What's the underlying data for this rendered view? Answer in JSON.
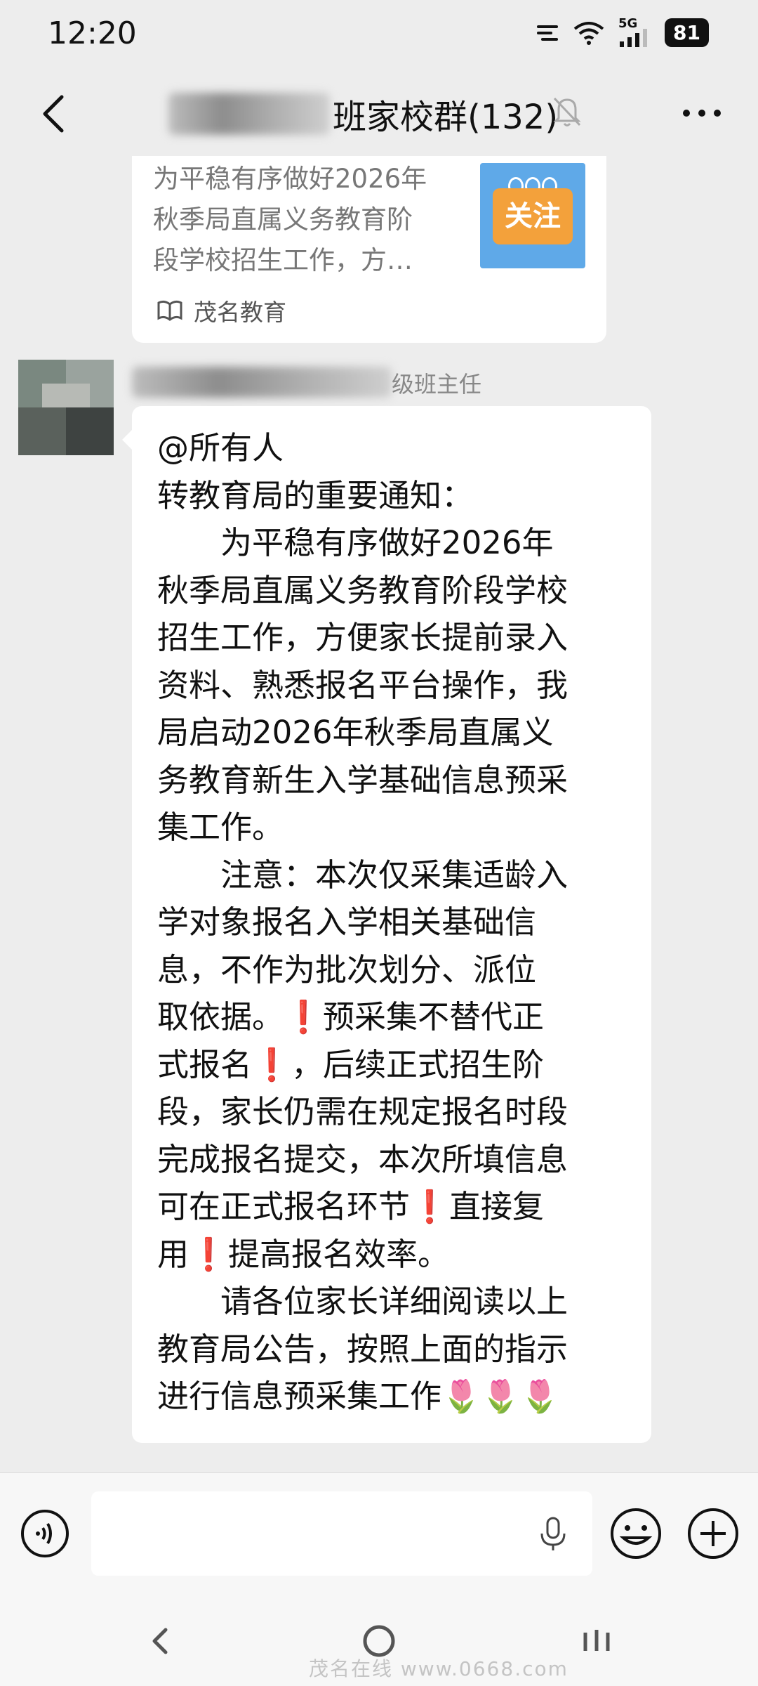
{
  "status_bar": {
    "time": "12:20",
    "network": "5G",
    "battery": "81"
  },
  "header": {
    "title": "班家校群(132)",
    "back_icon": "chevron-left-icon",
    "mute_icon": "bell-off-icon",
    "more_icon": "more-dots-icon"
  },
  "article_card": {
    "lines": [
      "为平稳有序做好2026年",
      "秋季局直属义务教育阶",
      "段学校招生工作，方…"
    ],
    "thumbnail_label": "关注",
    "source": "茂名教育",
    "source_icon": "book-open-icon"
  },
  "sender": {
    "name_suffix": "级班主任"
  },
  "message": {
    "lines": [
      "@所有人",
      "转教育局的重要通知：",
      "　　为平稳有序做好2026年",
      "秋季局直属义务教育阶段学校",
      "招生工作，方便家长提前录入",
      "资料、熟悉报名平台操作，我",
      "局启动2026年秋季局直属义",
      "务教育新生入学基础信息预采",
      "集工作。",
      "　　注意：本次仅采集适龄入",
      "学对象报名入学相关基础信",
      "息，不作为批次划分、派位",
      "取依据。❗预采集不替代正",
      "式报名❗，后续正式招生阶",
      "段，家长仍需在规定报名时段",
      "完成报名提交，本次所填信息",
      "可在正式报名环节❗直接复",
      "用❗提高报名效率。",
      "　　请各位家长详细阅读以上",
      "教育局公告，按照上面的指示",
      "进行信息预采集工作🌷🌷🌷"
    ]
  },
  "input_bar": {
    "voice_icon": "voice-icon",
    "mic_icon": "microphone-icon",
    "emoji_icon": "emoji-icon",
    "plus_icon": "plus-icon",
    "input_placeholder": ""
  },
  "nav_bar": {
    "back_icon": "nav-back-icon",
    "home_icon": "nav-home-icon",
    "recent_icon": "nav-recent-icon",
    "watermark": "茂名在线 www.0668.com"
  },
  "colors": {
    "background": "#ededed",
    "bubble": "#ffffff",
    "card_thumb_blue": "#5fa9e8",
    "card_thumb_orange": "#f3a13b",
    "exclamation_red": "#d8262b"
  }
}
